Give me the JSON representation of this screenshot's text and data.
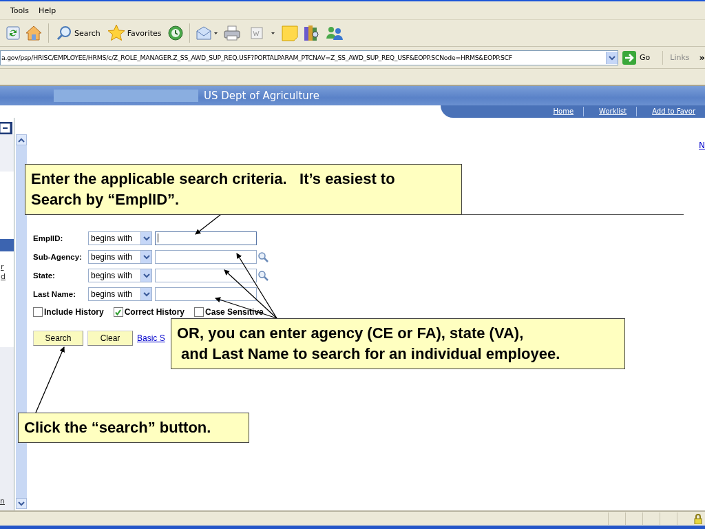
{
  "menu": [
    "Tools",
    "Help"
  ],
  "toolbar": {
    "search_label": "Search",
    "favorites_label": "Favorites"
  },
  "address": {
    "value": "a.gov/psp/HRISC/EMPLOYEE/HRMS/c/Z_ROLE_MANAGER.Z_SS_AWD_SUP_REQ.USF?PORTALPARAM_PTCNAV=Z_SS_AWD_SUP_REQ_USF&EOPP.SCNode=HRMS&EOPP.SCF",
    "go": "Go",
    "links": "Links",
    "more": "»"
  },
  "header": {
    "title": "US Dept of Agriculture",
    "nav": [
      "Home",
      "Worklist",
      "Add to Favor"
    ]
  },
  "sidebar": {
    "links": [
      "r",
      "d"
    ],
    "bottom_link": "n"
  },
  "right_link": "N",
  "form": {
    "fields": [
      {
        "label": "EmplID:",
        "operator": "begins with",
        "lookup": false,
        "focused": true
      },
      {
        "label": "Sub-Agency:",
        "operator": "begins with",
        "lookup": true,
        "focused": false
      },
      {
        "label": "State:",
        "operator": "begins with",
        "lookup": true,
        "focused": false
      },
      {
        "label": "Last Name:",
        "operator": "begins with",
        "lookup": false,
        "focused": false
      }
    ],
    "checkboxes": [
      {
        "label": "Include History",
        "checked": false
      },
      {
        "label": "Correct History",
        "checked": true
      },
      {
        "label": "Case Sensitive",
        "checked": false
      }
    ],
    "buttons": [
      "Search",
      "Clear"
    ],
    "link": "Basic S"
  },
  "callouts": [
    {
      "lines": [
        "Enter the applicable search criteria.   It’s easiest to",
        "Search by “EmplID”."
      ]
    },
    {
      "lines": [
        "OR, you can enter agency (CE or FA), state (VA),",
        " and Last Name to search for an individual employee."
      ]
    },
    {
      "lines": [
        "Click the “search” button."
      ]
    }
  ]
}
